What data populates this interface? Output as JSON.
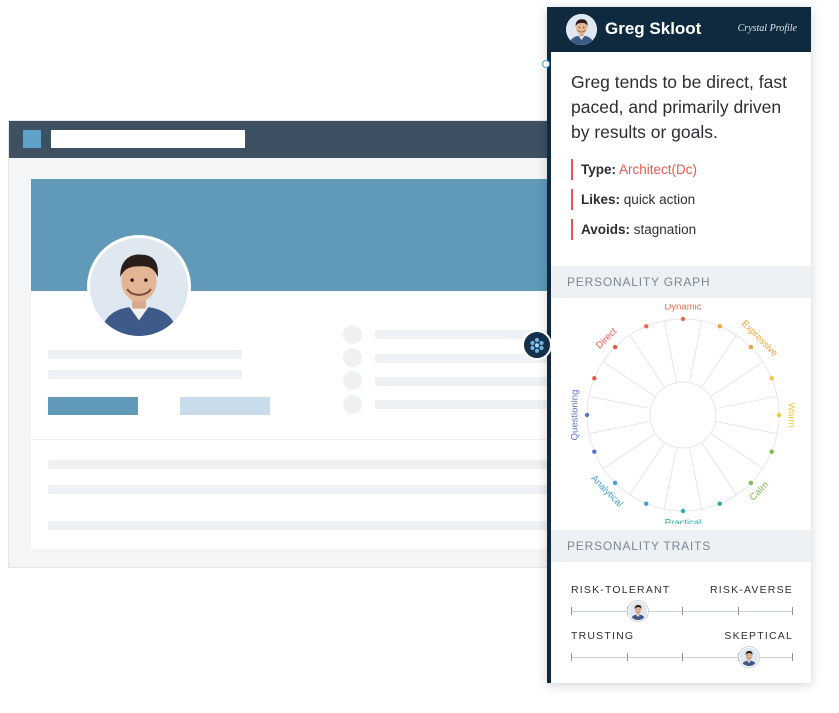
{
  "profile": {
    "name": "Greg Skloot",
    "brand": "Crystal Profile",
    "summary": "Greg tends to be direct, fast paced, and primarily driven by results or goals.",
    "type_label": "Type:",
    "type_value": "Architect(Dc)",
    "likes_label": "Likes:",
    "likes_value": "quick action",
    "avoids_label": "Avoids:",
    "avoids_value": "stagnation"
  },
  "personality_graph": {
    "heading": "PERSONALITY GRAPH",
    "segments": [
      {
        "name": "Dynamic",
        "color": "#e96b4f"
      },
      {
        "name": "Expressive",
        "color": "#f2a23a"
      },
      {
        "name": "Warm",
        "color": "#f3c53b"
      },
      {
        "name": "Calm",
        "color": "#7ebd4e"
      },
      {
        "name": "Practical",
        "color": "#2fa8a6"
      },
      {
        "name": "Analytical",
        "color": "#4a9ed8"
      },
      {
        "name": "Questioning",
        "color": "#5d73c6"
      },
      {
        "name": "Direct",
        "color": "#e05a4f"
      }
    ],
    "position": "Direct"
  },
  "personality_traits": {
    "heading": "PERSONALITY TRAITS",
    "items": [
      {
        "left": "RISK-TOLERANT",
        "right": "RISK-AVERSE",
        "level": 0.3
      },
      {
        "left": "TRUSTING",
        "right": "SKEPTICAL",
        "level": 0.8
      }
    ]
  },
  "colors": {
    "panel_header": "#0f2a3f",
    "accent": "#e05a4f",
    "cover": "#6199b8",
    "browser_bar": "#3d5163"
  }
}
